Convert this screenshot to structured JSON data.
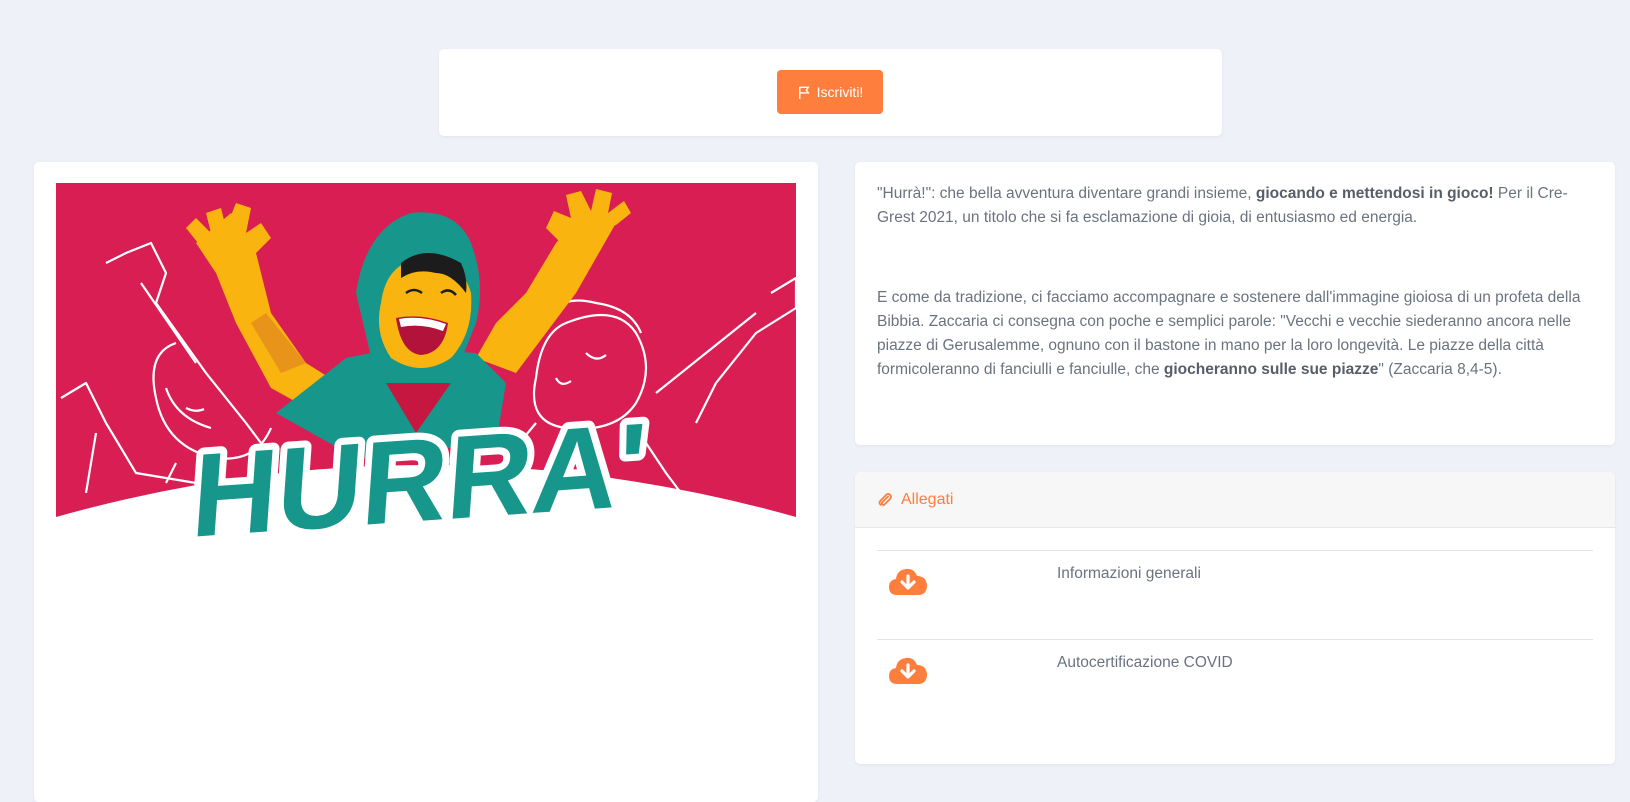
{
  "colors": {
    "accent": "#fd7e3d",
    "hero_background": "#d81e52",
    "teal": "#17968b",
    "yellow": "#f9b410"
  },
  "signup": {
    "label": "Iscriviti!",
    "icon": "flag-icon"
  },
  "hero": {
    "logo_text": "HURRA'"
  },
  "description": {
    "p1": [
      {
        "text": "\"Hurrà!\": che bella avventura diventare grandi insieme, ",
        "bold": false
      },
      {
        "text": "giocando e mettendosi in gioco!",
        "bold": true
      },
      {
        "text": " Per il Cre-Grest 2021, un titolo che si fa esclamazione di gioia, di entusiasmo ed energia.",
        "bold": false
      }
    ],
    "p2": [
      {
        "text": "E come da tradizione, ci facciamo accompagnare e sostenere dall'immagine gioiosa di un profeta della Bibbia. Zaccaria ci consegna con poche e semplici parole: \"Vecchi e vecchie siederanno ancora nelle piazze di Gerusalemme, ognuno con il bastone in mano per la loro longevità. Le piazze della città formicoleranno di fanciulli e fanciulle, che ",
        "bold": false
      },
      {
        "text": "giocheranno sulle sue piazze",
        "bold": true
      },
      {
        "text": "\" (Zaccaria 8,4-5).",
        "bold": false
      }
    ]
  },
  "attachments": {
    "title": "Allegati",
    "icon": "paperclip-icon",
    "items": [
      {
        "name": "Informazioni generali",
        "icon": "cloud-download-icon"
      },
      {
        "name": "Autocertificazione COVID",
        "icon": "cloud-download-icon"
      }
    ]
  }
}
